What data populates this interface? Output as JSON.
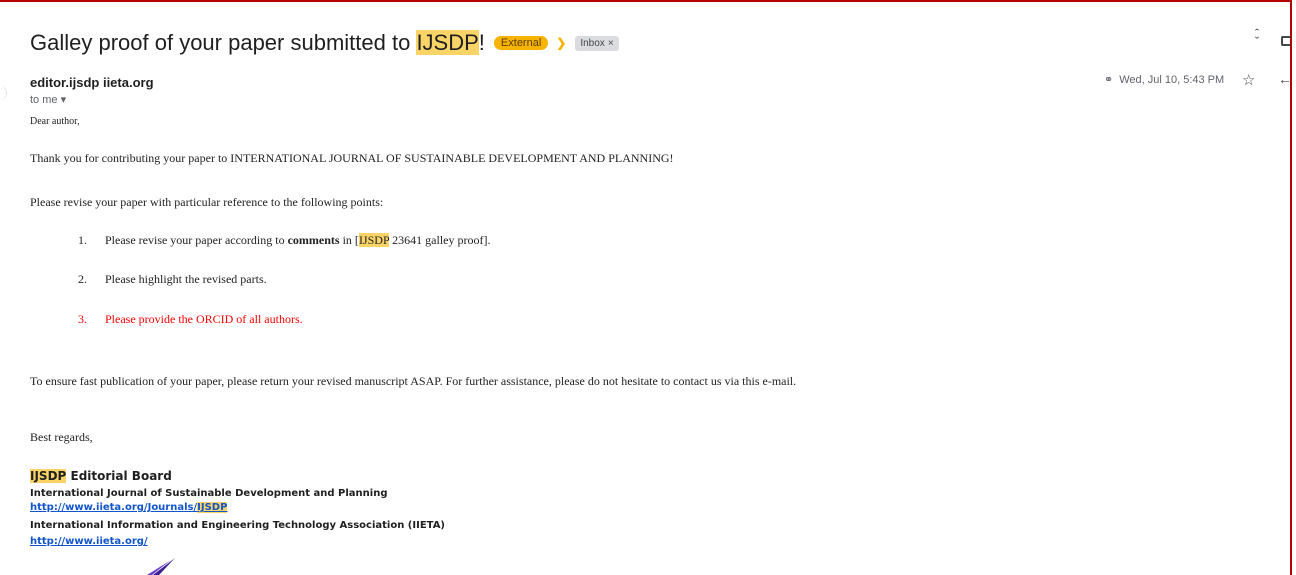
{
  "email": {
    "subject_prefix": "Galley proof of your paper submitted to ",
    "subject_highlight": "IJSDP",
    "subject_suffix": "!",
    "label_external": "External",
    "label_inbox": "Inbox",
    "label_remove": "×",
    "sender": "editor.ijsdp iieta.org",
    "recipient": "to me",
    "date": "Wed, Jul 10, 5:43 PM"
  },
  "body": {
    "greeting": "Dear author,",
    "thanks": "Thank you for contributing your paper to INTERNATIONAL JOURNAL OF SUSTAINABLE DEVELOPMENT AND PLANNING!",
    "intro": "Please revise your paper with particular reference to the following points:",
    "points": [
      {
        "num": "1.",
        "text_before": "Please revise your paper according to ",
        "bold": "comments",
        "text_mid": " in [",
        "highlight": "IJSDP",
        "text_after": " 23641 galley proof]."
      },
      {
        "num": "2.",
        "text": "Please highlight the revised parts."
      },
      {
        "num": "3.",
        "text": "Please provide the ORCID of all authors."
      }
    ],
    "closing": "To ensure fast publication of your paper, please return your revised manuscript ASAP.  For further assistance, please do not hesitate to contact us via this e-mail.",
    "regards": "Best regards,"
  },
  "signature": {
    "board_highlight": "IJSDP",
    "board_rest": " Editorial Board",
    "journal": "International Journal of Sustainable Development and Planning",
    "link1_prefix": "http://www.iieta.org/Journals/",
    "link1_highlight": "IJSDP",
    "org": "International Information and Engineering Technology Association (IIETA)",
    "link2": "http://www.iieta.org/"
  },
  "icons": {
    "attachment": "paperclip-icon",
    "star": "star-icon",
    "reply": "reply-icon",
    "collapse": "collapse-icon",
    "print": "print-icon",
    "importance": "importance-marker-icon",
    "dropdown": "chevron-down-icon"
  },
  "colors": {
    "highlight": "#fbd468",
    "external_chip": "#f6b400",
    "link": "#1155cc",
    "alert": "#ff0000",
    "frame": "#b40000"
  }
}
